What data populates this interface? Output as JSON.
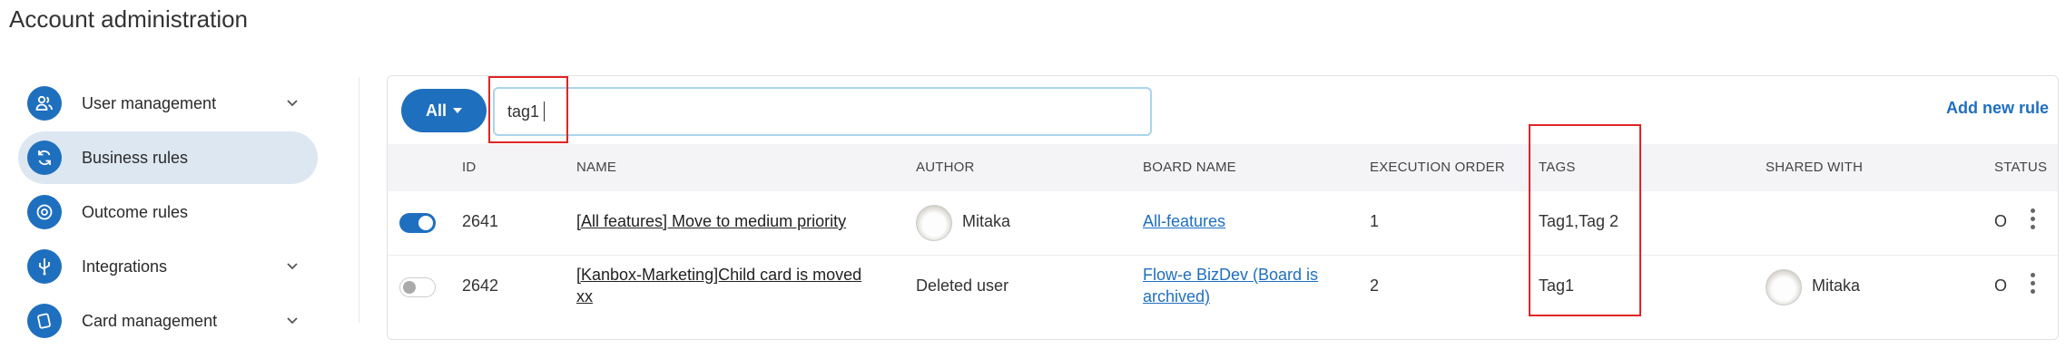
{
  "page": {
    "title": "Account administration"
  },
  "sidebar": {
    "items": [
      {
        "label": "User management",
        "icon": "users-icon",
        "expandable": true,
        "active": false
      },
      {
        "label": "Business rules",
        "icon": "refresh-icon",
        "expandable": false,
        "active": true
      },
      {
        "label": "Outcome rules",
        "icon": "target-icon",
        "expandable": false,
        "active": false
      },
      {
        "label": "Integrations",
        "icon": "usb-icon",
        "expandable": true,
        "active": false
      },
      {
        "label": "Card management",
        "icon": "card-icon",
        "expandable": true,
        "active": false
      }
    ]
  },
  "toolbar": {
    "filter_label": "All",
    "search_value": "tag1",
    "add_rule_label": "Add new rule"
  },
  "table": {
    "columns": [
      "ID",
      "NAME",
      "AUTHOR",
      "BOARD NAME",
      "EXECUTION ORDER",
      "TAGS",
      "SHARED WITH",
      "STATUS"
    ],
    "rows": [
      {
        "enabled": true,
        "id": "2641",
        "name": "[All features] Move to medium priority",
        "author": "Mitaka",
        "board_line1": "All-features",
        "board_line2": "",
        "execution_order": "1",
        "tags": "Tag1,Tag 2",
        "shared_with": "",
        "status": "O"
      },
      {
        "enabled": false,
        "id": "2642",
        "name_line1": "[Kanbox-Marketing]Child card is moved",
        "name_line2": "xx",
        "author": "Deleted user",
        "board_line1": "Flow-e BizDev (Board is",
        "board_line2": "archived)",
        "execution_order": "2",
        "tags": "Tag1",
        "shared_with": "Mitaka",
        "status": "O"
      }
    ]
  },
  "colors": {
    "accent": "#1f6fbf",
    "highlight": "#e02424",
    "active_bg": "#dde7f1"
  }
}
